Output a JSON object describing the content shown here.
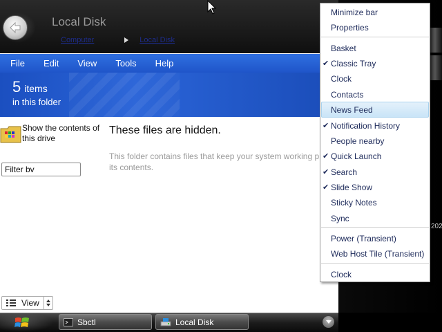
{
  "window": {
    "title": "Local Disk",
    "breadcrumbs": [
      "Computer",
      "Local Disk"
    ]
  },
  "menubar": [
    "File",
    "Edit",
    "View",
    "Tools",
    "Help"
  ],
  "info": {
    "count": "5",
    "count_label": "items",
    "subtitle": "in this folder"
  },
  "sidebar": {
    "show_contents": "Show the contents of this drive"
  },
  "filter": {
    "placeholder": "Filter bv"
  },
  "content": {
    "heading": "These files are hidden.",
    "desc_line1": "This folder contains files that keep your system working p",
    "desc_line2": "its contents."
  },
  "view_control": {
    "label": "View"
  },
  "taskbar": {
    "buttons": [
      "Sbctl",
      "Local Disk"
    ]
  },
  "desktop": {
    "edge_text": "202"
  },
  "context_menu": {
    "items": [
      {
        "label": "Minimize bar",
        "checked": false
      },
      {
        "label": "Properties",
        "checked": false
      },
      {
        "label": "Basket",
        "checked": false
      },
      {
        "label": "Classic Tray",
        "checked": true
      },
      {
        "label": "Clock",
        "checked": false
      },
      {
        "label": "Contacts",
        "checked": false
      },
      {
        "label": "News Feed",
        "checked": false,
        "highlighted": true
      },
      {
        "label": "Notification History",
        "checked": true
      },
      {
        "label": "People nearby",
        "checked": false
      },
      {
        "label": "Quick Launch",
        "checked": true
      },
      {
        "label": "Search",
        "checked": true
      },
      {
        "label": "Slide Show",
        "checked": true
      },
      {
        "label": "Sticky Notes",
        "checked": false
      },
      {
        "label": "Sync",
        "checked": false
      },
      {
        "label": "Power (Transient)",
        "checked": false
      },
      {
        "label": "Web Host Tile (Transient)",
        "checked": false
      },
      {
        "label": "Clock",
        "checked": false
      }
    ]
  },
  "colors": {
    "menubar": "#2f6fe0",
    "banner": "#1b4fc0",
    "menu_text": "#1d2a5a",
    "highlight": "#c9e4f7"
  }
}
